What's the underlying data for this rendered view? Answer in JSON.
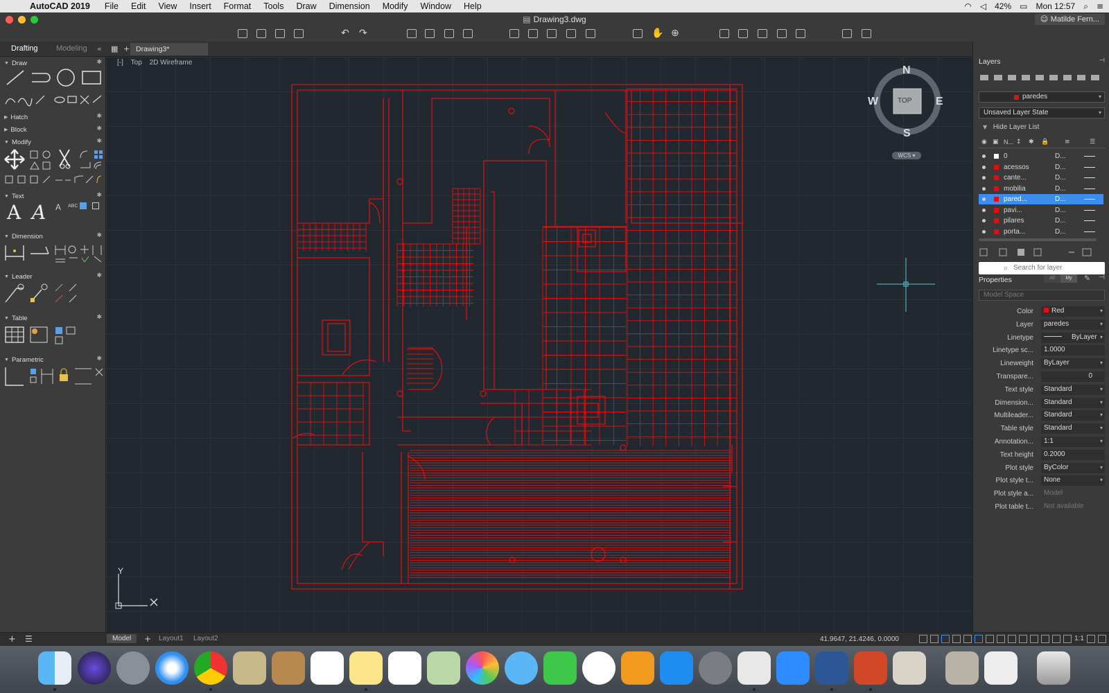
{
  "menubar": {
    "app_name": "AutoCAD 2019",
    "items": [
      "File",
      "Edit",
      "View",
      "Insert",
      "Format",
      "Tools",
      "Draw",
      "Dimension",
      "Modify",
      "Window",
      "Help"
    ],
    "battery": "42%",
    "clock": "Mon 12:57"
  },
  "window": {
    "title": "Drawing3.dwg",
    "user": "Matilde Fern..."
  },
  "workspace_tabs": [
    "Drafting",
    "Modeling"
  ],
  "document_tab": "Drawing3*",
  "palette": {
    "sections": [
      "Draw",
      "Hatch",
      "Block",
      "Modify",
      "Text",
      "Dimension",
      "Leader",
      "Table",
      "Parametric"
    ]
  },
  "viewport": {
    "view_label": "Top",
    "visual_style": "2D Wireframe",
    "compass": {
      "n": "N",
      "s": "S",
      "e": "E",
      "w": "W",
      "face": "TOP",
      "ucs": "WCS"
    },
    "axis_y": "Y"
  },
  "layers": {
    "title": "Layers",
    "current_layer": "paredes",
    "layer_state": "Unsaved Layer State",
    "hide_list": "Hide Layer List",
    "name_header": "N...",
    "rows": [
      {
        "name": "0",
        "desc": "D...",
        "color": "#ffffff"
      },
      {
        "name": "acessos",
        "desc": "D...",
        "color": "#e01010"
      },
      {
        "name": "cante...",
        "desc": "D...",
        "color": "#e01010"
      },
      {
        "name": "mobilia",
        "desc": "D...",
        "color": "#e01010"
      },
      {
        "name": "pared...",
        "desc": "D...",
        "color": "#e01010"
      },
      {
        "name": "pavi...",
        "desc": "D...",
        "color": "#e01010"
      },
      {
        "name": "pilares",
        "desc": "D...",
        "color": "#e01010"
      },
      {
        "name": "porta...",
        "desc": "D...",
        "color": "#e01010"
      }
    ],
    "selected_row": 4,
    "search_placeholder": "Search for layer"
  },
  "properties": {
    "title": "Properties",
    "tab_all": "All",
    "tab_my": "My",
    "space": "Model Space",
    "rows": [
      {
        "label": "Color",
        "value": "Red"
      },
      {
        "label": "Layer",
        "value": "paredes"
      },
      {
        "label": "Linetype",
        "value": "ByLayer"
      },
      {
        "label": "Linetype sc...",
        "value": "1.0000"
      },
      {
        "label": "Lineweight",
        "value": "ByLayer"
      },
      {
        "label": "Transpare...",
        "value": "0"
      },
      {
        "label": "Text style",
        "value": "Standard"
      },
      {
        "label": "Dimension...",
        "value": "Standard"
      },
      {
        "label": "Multileader...",
        "value": "Standard"
      },
      {
        "label": "Table style",
        "value": "Standard"
      },
      {
        "label": "Annotation...",
        "value": "1:1"
      },
      {
        "label": "Text height",
        "value": "0.2000"
      },
      {
        "label": "Plot style",
        "value": "ByColor"
      },
      {
        "label": "Plot style t...",
        "value": "None"
      },
      {
        "label": "Plot style a...",
        "value": "Model"
      },
      {
        "label": "Plot table t...",
        "value": "Not available"
      }
    ]
  },
  "layout_tabs": [
    "Model",
    "Layout1",
    "Layout2"
  ],
  "coordinates": "41.9647, 21.4246, 0.0000",
  "scale": "1:1",
  "colors": {
    "drawing": "#e01010",
    "accent": "#3d8df0",
    "canvas": "#212830"
  }
}
